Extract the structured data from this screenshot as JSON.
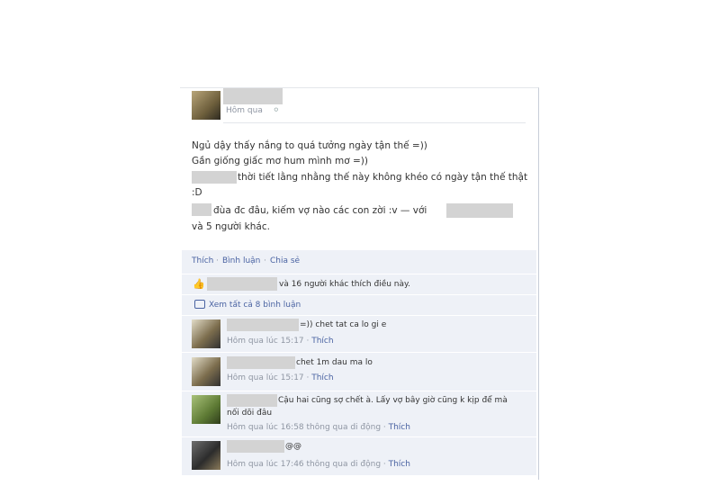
{
  "post": {
    "time": "Hôm qua",
    "lines": [
      "Ngủ dậy thấy nắng to quá tưởng ngày tận thế =))",
      "Gần giống giấc mơ hum mình mơ =))",
      "thời tiết lằng nhằng thế này không khéo có ngày tận thế thật",
      ":D",
      "đùa đc đâu, kiếm vợ nào các con zời :v — với",
      "và 5 người khác."
    ]
  },
  "actions": {
    "like": "Thích",
    "comment": "Bình luận",
    "share": "Chia sẻ",
    "sep": "·"
  },
  "likes_text": "và 16 người khác thích điều này.",
  "view_all": "Xem tất cả 8 bình luận",
  "comments": [
    {
      "text": "=)) chet tat ca lo gi e",
      "meta": "Hôm qua lúc 15:17 · ",
      "like": "Thích"
    },
    {
      "text": "chet 1m dau ma lo",
      "meta": "Hôm qua lúc 15:17 · ",
      "like": "Thích"
    },
    {
      "text": "Cậu hai cũng sợ chết à. Lấy vợ bây giờ cũng k kịp để mà",
      "text2": "nối dõi đâu",
      "meta": "Hôm qua lúc 16:58 thông qua di động · ",
      "like": "Thích"
    },
    {
      "text": "@@",
      "meta": "Hôm qua lúc 17:46 thông qua di động · ",
      "like": "Thích"
    }
  ]
}
